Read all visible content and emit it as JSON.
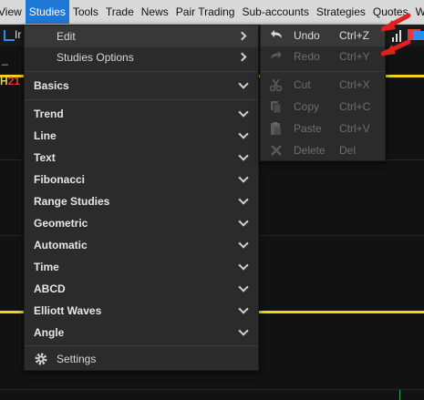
{
  "menubar": {
    "items": [
      "View",
      "Studies",
      "Tools",
      "Trade",
      "News",
      "Pair Trading",
      "Sub-accounts",
      "Strategies",
      "Quotes",
      "Worksp"
    ],
    "active_index": 1
  },
  "chart": {
    "symbol_fragment": "Ir",
    "h_label_prefix": "H",
    "h_label_value": "21",
    "underscore": "_"
  },
  "studies_menu": {
    "edit_label": "Edit",
    "studies_options_label": "Studies Options",
    "categories": [
      "Basics",
      "Trend",
      "Line",
      "Text",
      "Fibonacci",
      "Range Studies",
      "Geometric",
      "Automatic",
      "Time",
      "ABCD",
      "Elliott Waves",
      "Angle"
    ],
    "settings_label": "Settings"
  },
  "edit_submenu": {
    "items": [
      {
        "label": "Undo",
        "shortcut": "Ctrl+Z",
        "icon": "undo-icon",
        "enabled": true
      },
      {
        "label": "Redo",
        "shortcut": "Ctrl+Y",
        "icon": "redo-icon",
        "enabled": false
      },
      {
        "label": "Cut",
        "shortcut": "Ctrl+X",
        "icon": "scissors-icon",
        "enabled": false
      },
      {
        "label": "Copy",
        "shortcut": "Ctrl+C",
        "icon": "copy-icon",
        "enabled": false
      },
      {
        "label": "Paste",
        "shortcut": "Ctrl+V",
        "icon": "paste-icon",
        "enabled": false
      },
      {
        "label": "Delete",
        "shortcut": "Del",
        "icon": "delete-icon",
        "enabled": false
      }
    ]
  },
  "colors": {
    "accent": "#1e78d6",
    "menu_bg": "#2b2b2b",
    "chart_line": "#f2d21a",
    "annotation_red": "#e02020"
  }
}
